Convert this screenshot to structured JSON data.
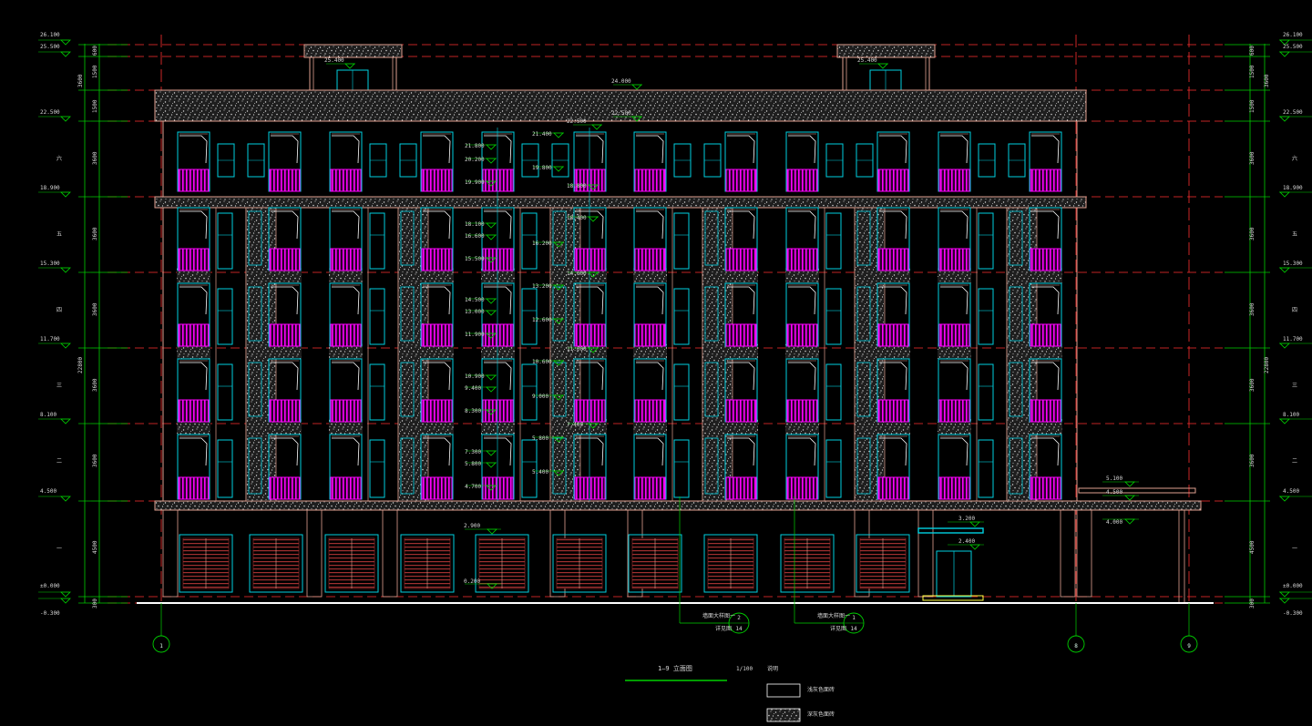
{
  "drawing": {
    "title": "1—9 立面图",
    "scale": "1/100",
    "legend_heading": "说明",
    "legend": [
      {
        "label": "浅灰色面砖"
      },
      {
        "label": "深灰色面砖"
      }
    ]
  },
  "axes": [
    "1",
    "8",
    "9"
  ],
  "elevations_left": [
    {
      "label": "26.100"
    },
    {
      "label": "25.500"
    },
    {
      "label": "22.500"
    },
    {
      "label": "18.900"
    },
    {
      "label": "15.300"
    },
    {
      "label": "11.700"
    },
    {
      "label": "8.100"
    },
    {
      "label": "4.500"
    },
    {
      "label": "±0.000"
    },
    {
      "label": "-0.300"
    }
  ],
  "elevations_right": [
    {
      "label": "26.100"
    },
    {
      "label": "25.500"
    },
    {
      "label": "22.500"
    },
    {
      "label": "18.900"
    },
    {
      "label": "15.300"
    },
    {
      "label": "11.700"
    },
    {
      "label": "8.100"
    },
    {
      "label": "4.500"
    },
    {
      "label": "±0.000"
    },
    {
      "label": "-0.300"
    }
  ],
  "dims_left": [
    "600",
    "1500",
    "3600",
    "1500",
    "3600",
    "3600",
    "3600",
    "3600",
    "3600",
    "4500",
    "300"
  ],
  "total_height": "22800",
  "floor_marks": [
    "六",
    "五",
    "四",
    "三",
    "二",
    "一"
  ],
  "top_marks": {
    "stair_roof_left": "25.400",
    "stair_roof_right": "25.400",
    "parapet": "24.000",
    "cornice": "22.500"
  },
  "stair_marks_a": [
    "21.800",
    "20.200",
    "19.900",
    "18.100",
    "16.600",
    "15.500",
    "14.500",
    "13.000",
    "11.900",
    "10.900",
    "9.400",
    "8.300",
    "7.300",
    "5.800",
    "4.700"
  ],
  "stair_marks_b": [
    "21.400",
    "19.800",
    "18.800",
    "18.400",
    "16.200",
    "14.600",
    "13.200",
    "12.600",
    "11.000",
    "10.600",
    "9.000",
    "7.400",
    "5.800",
    "5.400"
  ],
  "podium_marks": [
    "5.100",
    "4.500",
    "4.000"
  ],
  "ground_marks": [
    "2.900",
    "0.200",
    "3.200",
    "2.400"
  ],
  "callouts": [
    {
      "text": "墙面大样图一",
      "num": "2",
      "sheet": "14",
      "note": "详见图"
    },
    {
      "text": "墙面大样图一",
      "num": "1",
      "sheet": "14",
      "note": "详见图"
    }
  ],
  "colors": {
    "background": "#000000",
    "dimension": "#00d000",
    "axis_line": "#ff3030",
    "outline": "#e0a090",
    "window_frame": "#00d0e0",
    "railing": "#ff00ff",
    "stucco": "#bbbbbb"
  }
}
